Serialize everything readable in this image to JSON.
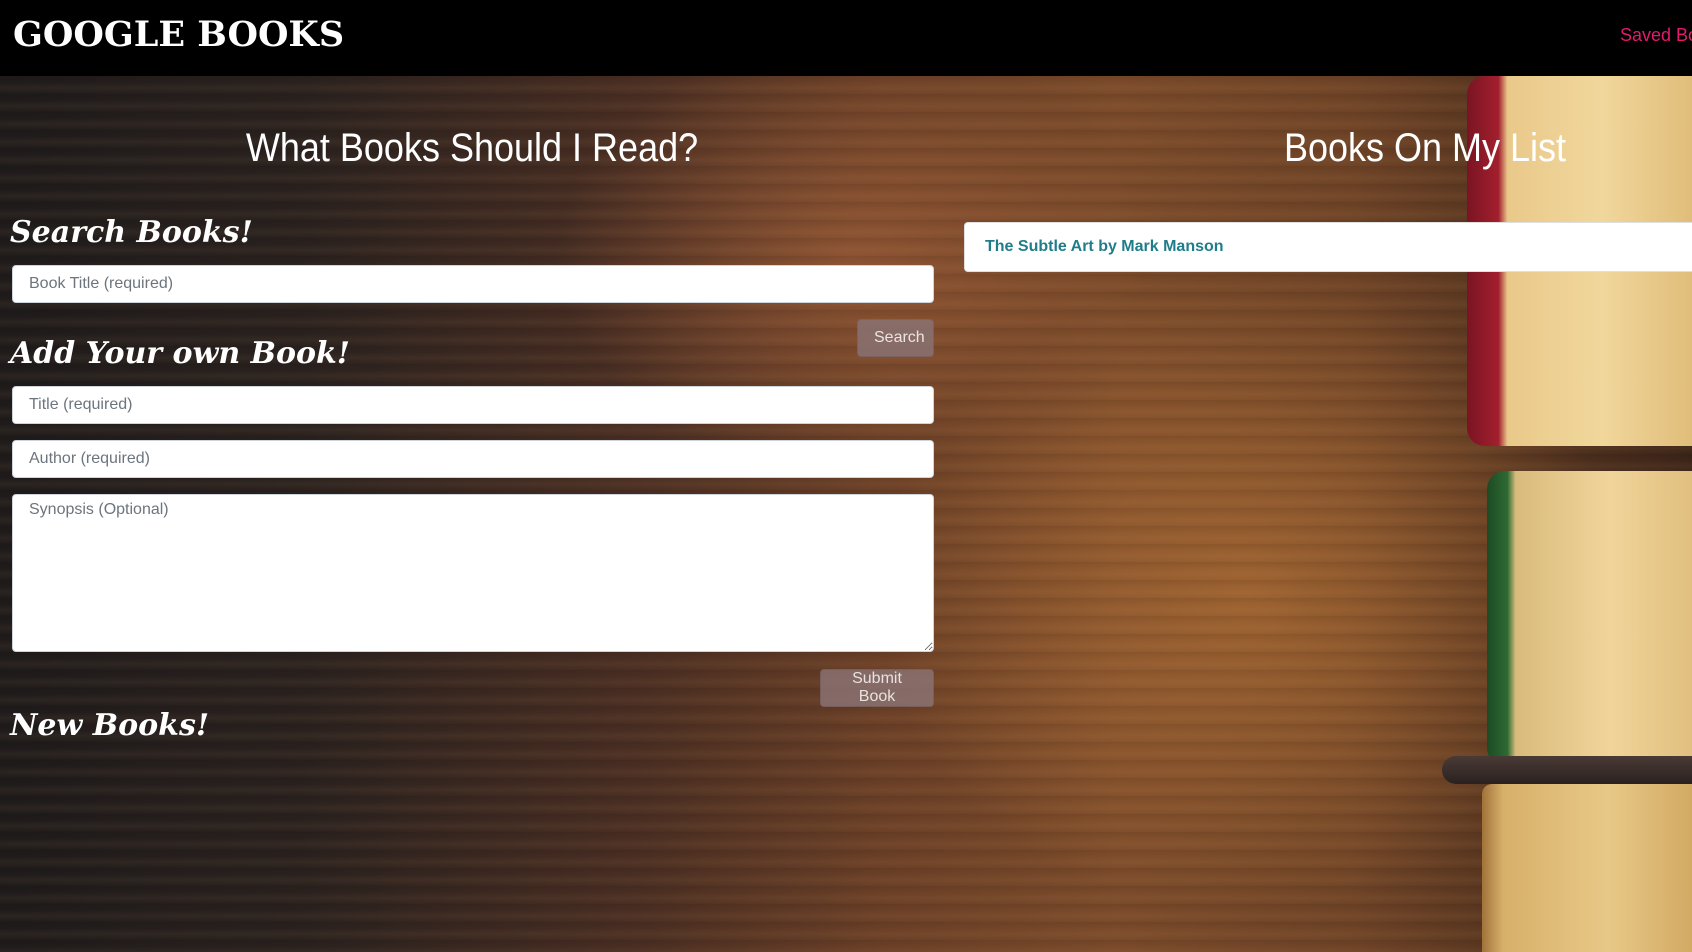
{
  "navbar": {
    "brand": "GOOGLE BOOKS",
    "link": "Saved Books"
  },
  "left": {
    "title": "What Books Should I Read?",
    "search_heading": "Search Books!",
    "search_placeholder": "Book Title (required)",
    "search_button": "Search",
    "add_heading": "Add Your own Book!",
    "title_placeholder": "Title (required)",
    "author_placeholder": "Author (required)",
    "synopsis_placeholder": "Synopsis (Optional)",
    "submit_button": "Submit Book",
    "new_heading": "New Books!"
  },
  "right": {
    "title": "Books On My List",
    "saved_books": [
      {
        "label": "The Subtle Art by Mark Manson"
      }
    ]
  },
  "colors": {
    "navbar_bg": "#000000",
    "nav_link": "#e5196e",
    "saved_link": "#1f7d8a",
    "button_bg": "#8a7272"
  }
}
